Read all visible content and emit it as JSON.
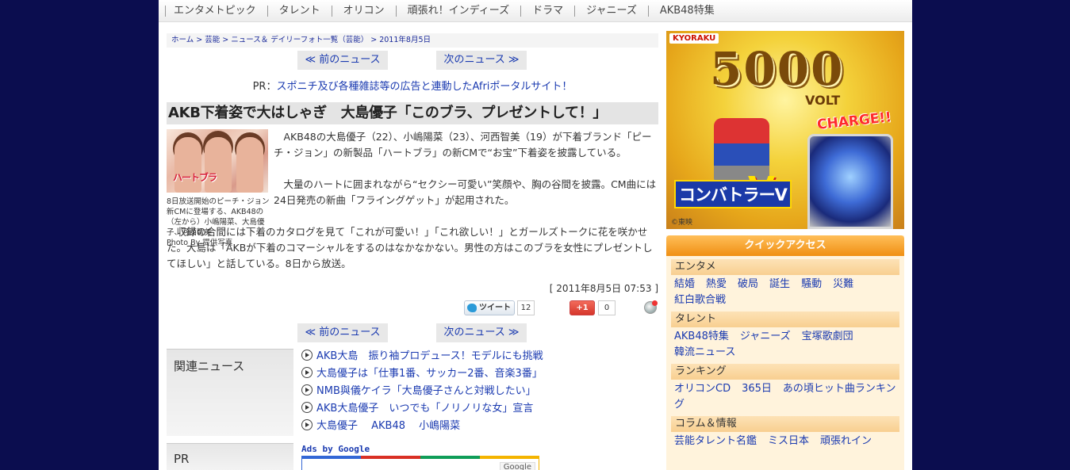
{
  "topnav": [
    "エンタメトピック",
    "タレント",
    "オリコン",
    "頑張れ！インディーズ",
    "ドラマ",
    "ジャニーズ",
    "AKB48特集"
  ],
  "breadcrumb": {
    "home": "ホーム",
    "sep": " > ",
    "geino": "芸能",
    "list": "ニュース＆ デイリーフォト一覧（芸能）",
    "date": "2011年8月5日"
  },
  "pager": {
    "prev": "≪ 前のニュース",
    "next": "次のニュース ≫"
  },
  "pr_top": {
    "label": "PR：",
    "link": "スポニチ及び各種雑誌等の広告と連動したAfriポータルサイト！"
  },
  "article": {
    "headline": "AKB下着姿で大はしゃぎ　大島優子「このブラ、プレゼントして！」",
    "photo_text": "ハートブラ",
    "caption": "8日放送開始のピーチ・ジョン新CMに登場する、AKB48の（左から）小嶋陽菜、大島優子、河西智美",
    "credit": "Photo By 提供写真",
    "p1": "AKB48の大島優子（22）、小嶋陽菜（23）、河西智美（19）が下着ブランド「ピーチ・ジョン」の新製品「ハートブラ」の新CMで“お宝”下着姿を披露している。",
    "p2": "大量のハートに囲まれながら“セクシー可愛い”笑顔や、胸の谷間を披露。CM曲には24日発売の新曲「フライングゲット」が起用された。",
    "p3": "収録の合間には下着のカタログを見て「これが可愛い！」「これ欲しい！」とガールズトークに花を咲かせた。大島は「AKBが下着のコマーシャルをするのはなかなかない。男性の方はこのブラを女性にプレゼントしてほしい」と話している。8日から放送。",
    "timestamp": "[ 2011年8月5日 07:53 ]"
  },
  "social": {
    "tweet_label": "ツイート",
    "tweet_count": "12",
    "gplus_label": "+1",
    "gplus_count": "0"
  },
  "related": {
    "heading": "関連ニュース",
    "items": [
      "AKB大島　振り袖プロデュース！モデルにも挑戦",
      "大島優子は「仕事1番、サッカー2番、音楽3番」",
      "NMB與儀ケイラ「大島優子さんと対戦したい」",
      "AKB大島優子　いつでも「ノリノリな女」宣言",
      "大島優子　 AKB48　 小嶋陽菜"
    ]
  },
  "pr_section": {
    "heading": "PR",
    "ads_label": "Ads by Google",
    "google": "Google"
  },
  "banner": {
    "brand": "KYORAKU",
    "big": "5000",
    "volt": "VOLT",
    "charge": "CHARGE!!",
    "title": "コンバトラーV",
    "v": "V",
    "copy": "©東映"
  },
  "quick": {
    "heading": "クイックアクセス",
    "sections": [
      {
        "title": "エンタメ",
        "links": [
          "結婚",
          "熱愛",
          "破局",
          "誕生",
          "騒動",
          "災難",
          "紅白歌合戦"
        ]
      },
      {
        "title": "タレント",
        "links": [
          "AKB48特集",
          "ジャニーズ",
          "宝塚歌劇団",
          "韓流ニュース"
        ]
      },
      {
        "title": "ランキング",
        "links": [
          "オリコンCD",
          "365日",
          "あの頃ヒット曲ランキング"
        ]
      },
      {
        "title": "コラム＆情報",
        "links": [
          "芸能タレント名鑑",
          "ミス日本",
          "頑張れイン"
        ]
      }
    ]
  }
}
